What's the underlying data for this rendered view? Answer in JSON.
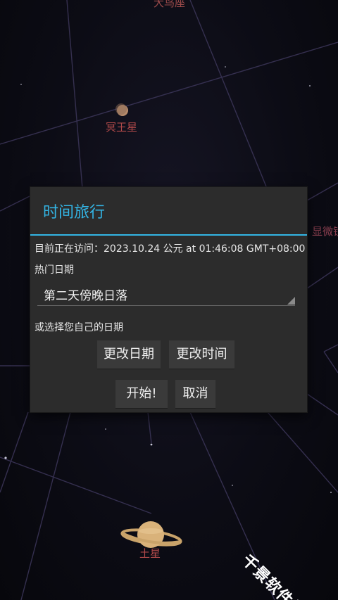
{
  "sky": {
    "labels": {
      "top": "大鸟座",
      "pluto": "冥王星",
      "micro": "显微镜",
      "saturn": "土星"
    }
  },
  "dialog": {
    "title": "时间旅行",
    "visiting": "目前正在访问：2023.10.24 公元 at 01:46:08 GMT+08:00",
    "hot_dates_label": "热门日期",
    "hot_dates_selected": "第二天傍晚日落",
    "or_choose_label": "或选择您自己的日期",
    "change_date_label": "更改日期",
    "change_time_label": "更改时间",
    "start_label": "开始!",
    "cancel_label": "取消"
  },
  "watermark": "千景软件站",
  "colors": {
    "accent": "#33b5e5",
    "dialog_bg": "#2c2c2c",
    "button_bg": "#3a3a3a",
    "sky_label": "#b24a4a"
  }
}
